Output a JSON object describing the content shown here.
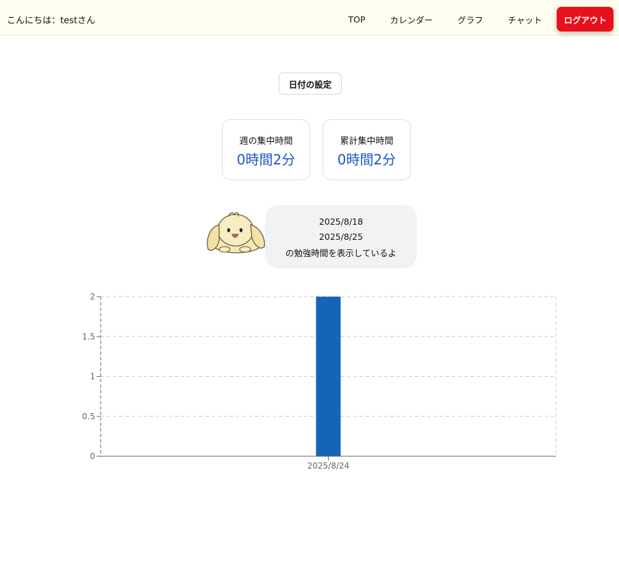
{
  "header": {
    "greeting": "こんにちは：testさん",
    "nav": [
      {
        "label": "TOP"
      },
      {
        "label": "カレンダー"
      },
      {
        "label": "グラフ"
      },
      {
        "label": "チャット"
      }
    ],
    "logout_label": "ログアウト",
    "logout_color": "#e8101b"
  },
  "date_button_label": "日付の設定",
  "cards": [
    {
      "label": "週の集中時間",
      "value": "0時間2分"
    },
    {
      "label": "累計集中時間",
      "value": "0時間2分"
    }
  ],
  "bubble": {
    "start": "2025/8/18",
    "end": "2025/8/25",
    "message": "の勉強時間を表示しているよ"
  },
  "mascot": {
    "icon": "dog-mascot-icon"
  },
  "chart_data": {
    "type": "bar",
    "categories": [
      "2025/8/24"
    ],
    "values": [
      2
    ],
    "ylim": [
      0,
      2
    ],
    "yticks": [
      "0",
      "0.5",
      "1",
      "1.5",
      "2"
    ],
    "grid": true,
    "bar_color": "#1565b7",
    "title": "",
    "xlabel": "",
    "ylabel": ""
  }
}
